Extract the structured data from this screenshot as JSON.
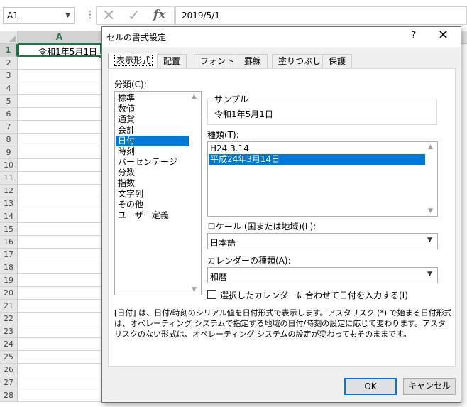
{
  "formula_bar": {
    "name_box": "A1",
    "formula": "2019/5/1"
  },
  "sheet": {
    "columns": [
      "A"
    ],
    "rows": [
      "1",
      "2",
      "3",
      "4",
      "5",
      "6",
      "7",
      "8",
      "9",
      "10",
      "11",
      "12",
      "13",
      "14",
      "15",
      "16",
      "17",
      "18",
      "19",
      "20",
      "21",
      "22",
      "23",
      "24",
      "25",
      "26",
      "27",
      "28"
    ],
    "a1_value": "令和1年5月1日"
  },
  "dialog": {
    "title": "セルの書式設定",
    "help": "?",
    "close": "✕",
    "tabs": [
      "表示形式",
      "配置",
      "フォント",
      "罫線",
      "塗りつぶし",
      "保護"
    ],
    "active_tab": "表示形式",
    "category_label": "分類(C):",
    "categories": [
      "標準",
      "数値",
      "通貨",
      "会計",
      "日付",
      "時刻",
      "パーセンテージ",
      "分数",
      "指数",
      "文字列",
      "その他",
      "ユーザー定義"
    ],
    "selected_category": "日付",
    "sample_label": "サンプル",
    "sample_value": "令和1年5月1日",
    "type_label": "種類(T):",
    "types": [
      "H24.3.14",
      "平成24年3月14日"
    ],
    "selected_type": "平成24年3月14日",
    "locale_label": "ロケール (国または地域)(L):",
    "locale_value": "日本語",
    "calendar_label": "カレンダーの種類(A):",
    "calendar_value": "和暦",
    "checkbox_label": "選択したカレンダーに合わせて日付を入力する(I)",
    "checkbox_checked": false,
    "description": "[日付] は、日付/時刻のシリアル値を日付形式で表示します。アスタリスク (*) で始まる日付形式は、オペレーティング システムで指定する地域の日付/時刻の設定に応じて変わります。アスタリスクのない形式は、オペレーティング システムの設定が変わってもそのままです。",
    "ok_label": "OK",
    "cancel_label": "キャンセル"
  },
  "colors": {
    "excel_green": "#217346",
    "selection_blue": "#0078d7"
  }
}
